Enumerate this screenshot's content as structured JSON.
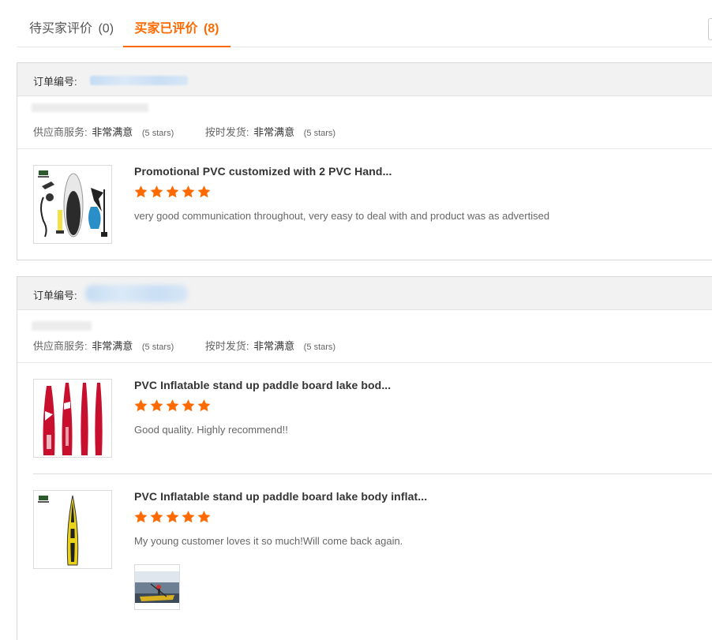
{
  "tabs": {
    "pending": {
      "label": "待买家评价",
      "count": "(0)"
    },
    "done": {
      "label": "买家已评价",
      "count": "(8)"
    }
  },
  "orders": [
    {
      "order_label": "订单编号:",
      "service_label": "供应商服务:",
      "service_value": "非常满意",
      "service_stars": "(5 stars)",
      "delivery_label": "按时发货:",
      "delivery_value": "非常满意",
      "delivery_stars": "(5 stars)",
      "items": [
        {
          "title": "Promotional PVC customized with 2 PVC Hand...",
          "rating": 5,
          "comment": "very good communication throughout, very easy to deal with and product was as advertised"
        }
      ]
    },
    {
      "order_label": "订单编号:",
      "service_label": "供应商服务:",
      "service_value": "非常满意",
      "service_stars": "(5 stars)",
      "delivery_label": "按时发货:",
      "delivery_value": "非常满意",
      "delivery_stars": "(5 stars)",
      "items": [
        {
          "title": "PVC Inflatable stand up paddle board lake bod...",
          "rating": 5,
          "comment": "Good quality. Highly recommend!!"
        },
        {
          "title": "PVC Inflatable stand up paddle board lake body inflat...",
          "rating": 5,
          "comment": "My young customer loves it so much!Will come back again."
        }
      ]
    }
  ],
  "colors": {
    "accent": "#ff6a00",
    "star": "#ff6a00",
    "header_bg": "#f2f2f2"
  }
}
